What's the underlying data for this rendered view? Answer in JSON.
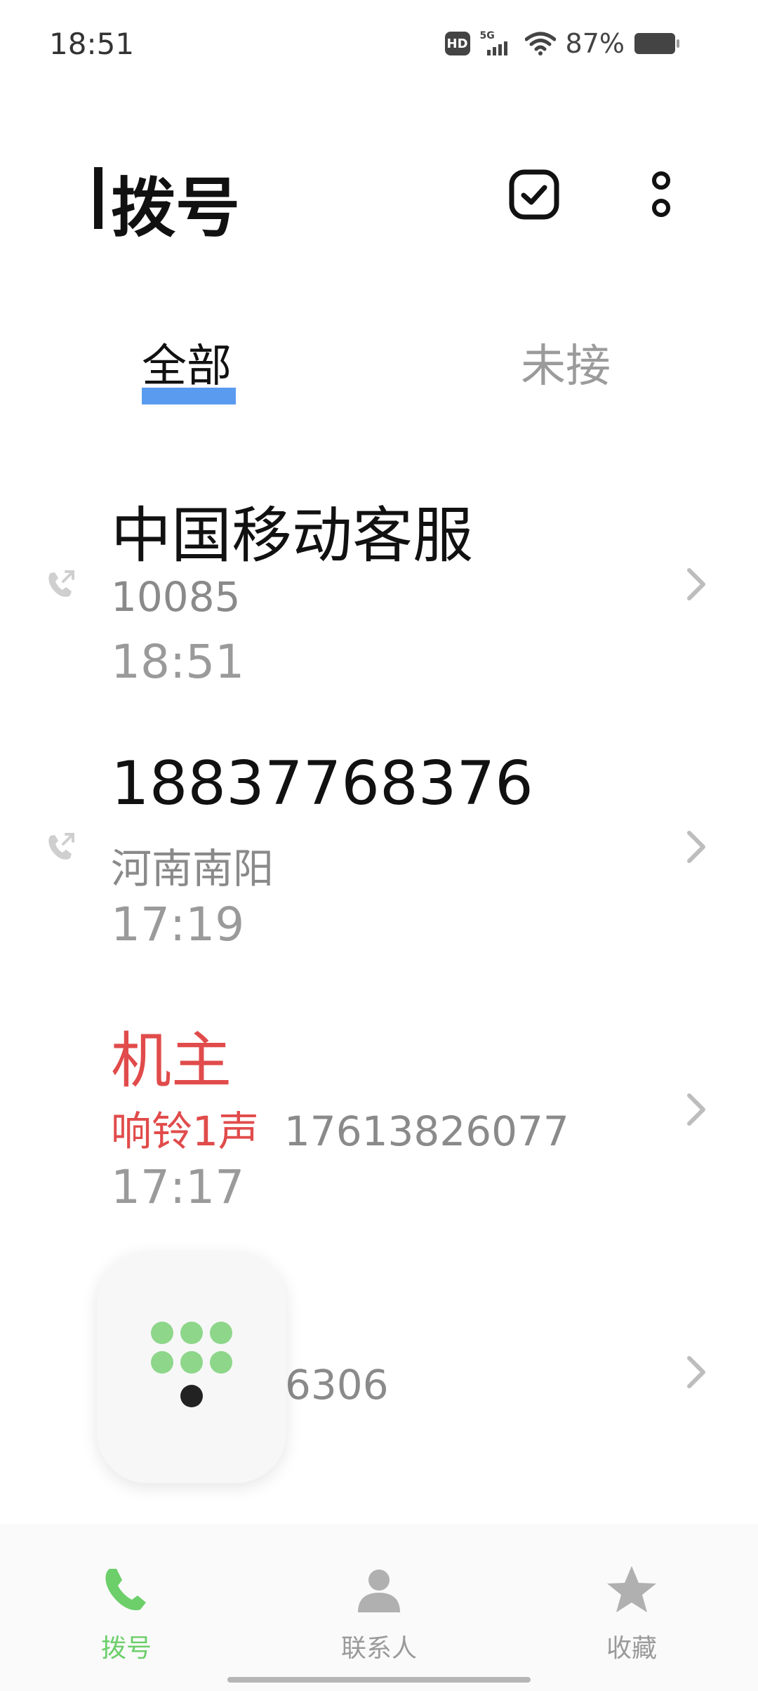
{
  "status_bar": {
    "time": "18:51",
    "hd": "HD",
    "network": "5G",
    "battery_percent": "87%"
  },
  "header": {
    "title": "拨号",
    "edit_icon": "checkbox-edit-icon",
    "more_icon": "more-vertical-icon"
  },
  "tabs": {
    "all": "全部",
    "missed": "未接"
  },
  "calls": [
    {
      "name": "中国移动客服",
      "detail": "10085",
      "time": "18:51",
      "type": "outgoing"
    },
    {
      "name": "18837768376",
      "detail": "河南南阳",
      "time": "17:19",
      "type": "outgoing"
    },
    {
      "name": "机主",
      "ring": "响铃1声",
      "detail": "17613826077",
      "time": "17:17",
      "type": "missed"
    },
    {
      "name": "",
      "detail": "6306",
      "time": "",
      "type": "unknown"
    }
  ],
  "bottom_nav": {
    "dial": "拨号",
    "contacts": "联系人",
    "favorites": "收藏"
  },
  "colors": {
    "accent_green": "#6ccf6a",
    "tab_indicator": "#5a9bf0",
    "missed_red": "#e14b4b"
  }
}
